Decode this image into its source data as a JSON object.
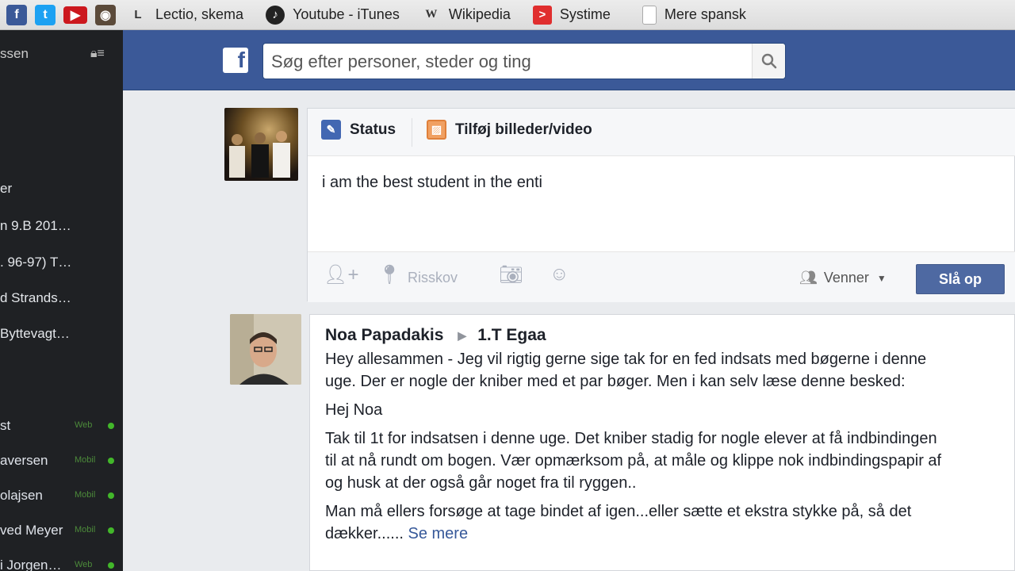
{
  "bookmarks": {
    "items": [
      {
        "label": "Lectio, skema",
        "icon": "lectio-icon"
      },
      {
        "label": "Youtube - iTunes",
        "icon": "itunes-icon"
      },
      {
        "label": "Wikipedia",
        "icon": "wikipedia-icon"
      },
      {
        "label": "Systime",
        "icon": "systime-icon"
      },
      {
        "label": "Mere spansk",
        "icon": "document-icon"
      }
    ]
  },
  "sidebar": {
    "user_name_partial": "ssen",
    "groups": [
      "er",
      "n 9.B 201…",
      ". 96-97) T…",
      "d Strands…",
      "Byttevagt…"
    ],
    "chat": [
      {
        "name": "st",
        "status": "Web"
      },
      {
        "name": "aversen",
        "status": "Mobil"
      },
      {
        "name": "olajsen",
        "status": "Mobil"
      },
      {
        "name": "ved Meyer",
        "status": "Mobil"
      },
      {
        "name": "i Jorgen…",
        "status": "Web"
      }
    ]
  },
  "header": {
    "search_placeholder": "Søg efter personer, steder og ting",
    "logo_letter": "f"
  },
  "composer": {
    "tab_status": "Status",
    "tab_photo": "Tilføj billeder/video",
    "text": "i am the best student in the enti",
    "location": "Risskov",
    "audience": "Venner",
    "post_button": "Slå op"
  },
  "post": {
    "author": "Noa Papadakis",
    "target": "1.T Egaa",
    "paragraphs": [
      "Hey allesammen - Jeg vil rigtig gerne sige tak for en fed indsats med bøgerne i denne uge. Der er nogle der kniber med et par bøger. Men i kan selv læse denne besked:",
      "Hej Noa",
      "Tak til 1t for indsatsen i denne uge. Det kniber stadig for nogle elever at få indbindingen til at nå rundt om bogen. Vær opmærksom på, at måle og klippe nok indbindingspapir af og husk at der også går noget fra til ryggen..",
      "Man må ellers forsøge at tage bindet af igen...eller sætte et ekstra stykke på, så det dækker......"
    ],
    "see_more": "Se mere"
  }
}
